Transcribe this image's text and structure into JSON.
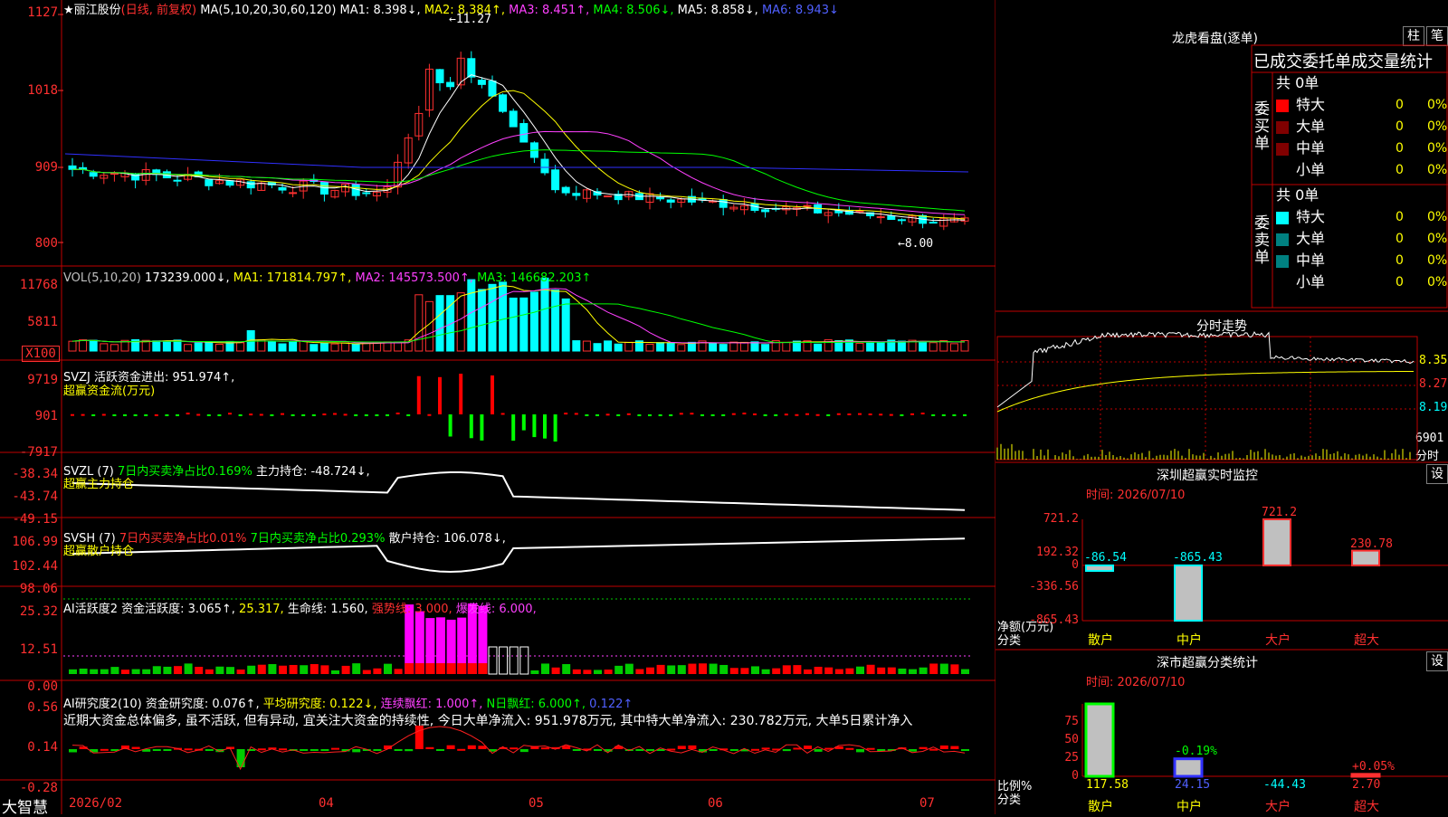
{
  "colors": {
    "up": "#ff3030",
    "down": "#00ffff",
    "grid": "#c00000",
    "bg": "#000000"
  },
  "main": {
    "star": "★",
    "stock": "丽江股份",
    "mode": "(日线, 前复权)",
    "ma_label": "MA(5,10,20,30,60,120)",
    "ma1": "MA1: 8.398↓,",
    "ma2": "MA2: 8.384↑,",
    "ma3": "MA3: 8.451↑,",
    "ma4": "MA4: 8.506↓,",
    "ma5": "MA5: 8.858↓,",
    "ma6": "MA6: 8.943↓",
    "high_mark": "←11.27",
    "low_mark": "←8.00",
    "yticks": [
      "1127",
      "1018",
      "909",
      "800"
    ]
  },
  "vol": {
    "label": "VOL(5,10,20)",
    "v": "173239.000↓,",
    "ma1": "MA1: 171814.797↑,",
    "ma2": "MA2: 145573.500↑,",
    "ma3": "MA3: 146682.203↑",
    "yticks": [
      "11768",
      "5811",
      "X100"
    ]
  },
  "svzj": {
    "label": "SVZJ  活跃资金进出: 951.974↑,",
    "sub": "超赢资金流(万元)",
    "yticks": [
      "9719",
      "901",
      "-7917"
    ]
  },
  "svzl": {
    "l1": "SVZL (7)",
    "l2": "7日内买卖净占比0.169%",
    "l3": "主力持仓: -48.724↓,",
    "sub": "超赢主力持仓",
    "yticks": [
      "-38.34",
      "-43.74",
      "-49.15"
    ]
  },
  "svsh": {
    "l1": "SVSH (7)",
    "l2": "7日内买卖净占比0.01%",
    "l3": "7日内买卖净占比0.293%",
    "l4": "散户持仓: 106.078↓,",
    "sub": "超赢散户持仓",
    "yticks": [
      "106.99",
      "102.44",
      "98.06"
    ]
  },
  "ai1": {
    "l1": "AI活跃度2",
    "l2": "资金活跃度: 3.065↑,",
    "l3": "25.317,",
    "l4": "生命线: 1.560,",
    "l5": "强势线: 3.000,",
    "l6": "爆发线: 6.000,",
    "yticks": [
      "25.32",
      "12.51",
      "0.00"
    ]
  },
  "ai2": {
    "l1": "AI研究度2(10)",
    "l2": "资金研究度: 0.076↑,",
    "l3": "平均研究度: 0.122↓,",
    "l4": "连续飘红: 1.000↑,",
    "l5": "N日飘红: 6.000↑,",
    "l6": "0.122↑",
    "comment": "近期大资金总体偏多, 虽不活跃, 但有异动, 宜关注大资金的持续性, 今日大单净流入: 951.978万元, 其中特大单净流入: 230.782万元, 大单5日累计净入",
    "yticks": [
      "0.56",
      "0.14",
      "-0.28"
    ]
  },
  "xaxis": {
    "brand": "大智慧",
    "labels": [
      "2026/02",
      "04",
      "05",
      "06",
      "07"
    ]
  },
  "lhb": {
    "title": "龙虎看盘(逐单)",
    "btn1": "柱",
    "btn2": "笔",
    "sub": "已成交委托单成交量统计",
    "buy_label": "委买单",
    "sell_label": "委卖单",
    "buy_total": "共 0单",
    "sell_total": "共 0单",
    "rows": [
      {
        "name": "特大",
        "val": "0",
        "pct": "0%"
      },
      {
        "name": "大单",
        "val": "0",
        "pct": "0%"
      },
      {
        "name": "中单",
        "val": "0",
        "pct": "0%"
      },
      {
        "name": "小单",
        "val": "0",
        "pct": "0%"
      }
    ]
  },
  "fs": {
    "title": "分时走势",
    "yticks": [
      "8.35",
      "8.27",
      "8.19"
    ],
    "vol": "6901",
    "vol_unit": "分时"
  },
  "monitor": {
    "title": "深圳超赢实时监控",
    "btn": "设",
    "time": "时间: 2026/07/10",
    "yticks": [
      "721.2",
      "192.32",
      "0",
      "-336.56",
      "-865.43"
    ],
    "ylabel": "净额(万元)",
    "xlabel": "分类",
    "cats": [
      "散户",
      "中户",
      "大户",
      "超大"
    ],
    "values": [
      -86.54,
      -865.43,
      721.2,
      230.78
    ],
    "labels": [
      "-86.54",
      "-865.43",
      "721.2",
      "230.78"
    ]
  },
  "stats": {
    "title": "深市超赢分类统计",
    "btn": "设",
    "time": "时间: 2026/07/10",
    "yticks": [
      "75",
      "50",
      "25",
      "0"
    ],
    "ylabel": "比例%",
    "xlabel": "分类",
    "cats": [
      "散户",
      "中户",
      "大户",
      "超大"
    ],
    "bar_values": [
      100,
      24.15,
      0,
      2.7
    ],
    "bottom": [
      "117.58",
      "24.15",
      "-44.43",
      "2.70"
    ],
    "top": [
      "",
      "-0.19%",
      "",
      "+0.05%"
    ]
  }
}
